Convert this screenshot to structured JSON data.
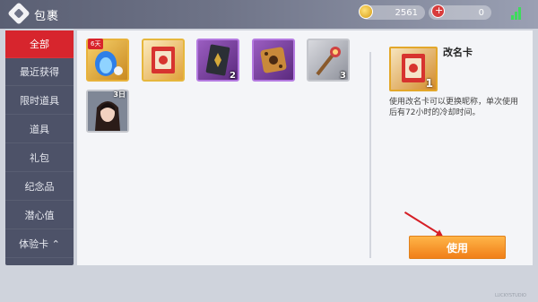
{
  "header": {
    "title": "包裹",
    "gold_value": "2561",
    "red_value": "0"
  },
  "sidebar": {
    "items": [
      {
        "label": "全部",
        "active": true
      },
      {
        "label": "最近获得",
        "active": false
      },
      {
        "label": "限时道具",
        "active": false
      },
      {
        "label": "道具",
        "active": false
      },
      {
        "label": "礼包",
        "active": false
      },
      {
        "label": "纪念品",
        "active": false
      },
      {
        "label": "潜心值",
        "active": false
      },
      {
        "label": "体验卡 ⌃",
        "active": false
      }
    ]
  },
  "inventory": {
    "items": [
      {
        "name": "blue-fire-bundle",
        "badge": "6天",
        "count": ""
      },
      {
        "name": "rename-card",
        "badge": "",
        "count": ""
      },
      {
        "name": "dark-card",
        "badge": "",
        "count": "2"
      },
      {
        "name": "dice-box",
        "badge": "",
        "count": ""
      },
      {
        "name": "gem-staff",
        "badge": "",
        "count": "3"
      },
      {
        "name": "character-card",
        "badge": "3日",
        "count": ""
      }
    ]
  },
  "detail": {
    "name": "改名卡",
    "count": "1",
    "description": "使用改名卡可以更换昵称，单次使用后有72小时的冷却时间。",
    "use_button": "使用"
  },
  "footer": {
    "text": "LUCKYSTUDIO"
  },
  "colors": {
    "accent_red": "#d7252d",
    "sidebar_bg": "#4d5268",
    "button_orange": "#f07c16",
    "gold_border": "#e3a72a"
  }
}
